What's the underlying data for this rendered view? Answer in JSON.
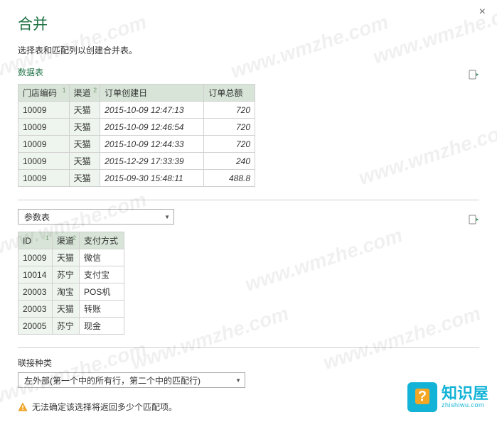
{
  "dialog": {
    "title": "合并",
    "subtitle": "选择表和匹配列以创建合并表。",
    "close": "×"
  },
  "section1": {
    "label": "数据表",
    "headers": {
      "c1": "门店编码",
      "c2": "渠道",
      "c3": "订单创建日",
      "c4": "订单总额",
      "idx1": "1",
      "idx2": "2"
    },
    "rows": [
      {
        "c1": "10009",
        "c2": "天猫",
        "c3": "2015-10-09 12:47:13",
        "c4": "720"
      },
      {
        "c1": "10009",
        "c2": "天猫",
        "c3": "2015-10-09 12:46:54",
        "c4": "720"
      },
      {
        "c1": "10009",
        "c2": "天猫",
        "c3": "2015-10-09 12:44:33",
        "c4": "720"
      },
      {
        "c1": "10009",
        "c2": "天猫",
        "c3": "2015-12-29 17:33:39",
        "c4": "240"
      },
      {
        "c1": "10009",
        "c2": "天猫",
        "c3": "2015-09-30 15:48:11",
        "c4": "488.8"
      }
    ]
  },
  "source_dropdown": "参数表",
  "section2": {
    "headers": {
      "c1": "ID",
      "c2": "渠道",
      "c3": "支付方式",
      "idx1": "1",
      "idx2": "2"
    },
    "rows": [
      {
        "c1": "10009",
        "c2": "天猫",
        "c3": "微信"
      },
      {
        "c1": "10014",
        "c2": "苏宁",
        "c3": "支付宝"
      },
      {
        "c1": "20003",
        "c2": "淘宝",
        "c3": "POS机"
      },
      {
        "c1": "20003",
        "c2": "天猫",
        "c3": "转账"
      },
      {
        "c1": "20005",
        "c2": "苏宁",
        "c3": "现金"
      }
    ]
  },
  "join": {
    "label": "联接种类",
    "value": "左外部(第一个中的所有行，第二个中的匹配行)"
  },
  "warning": "无法确定该选择将返回多少个匹配项。",
  "watermark": "www.wmzhe.com",
  "logo": {
    "main": "知识屋",
    "sub": "zhishiwu.com"
  }
}
